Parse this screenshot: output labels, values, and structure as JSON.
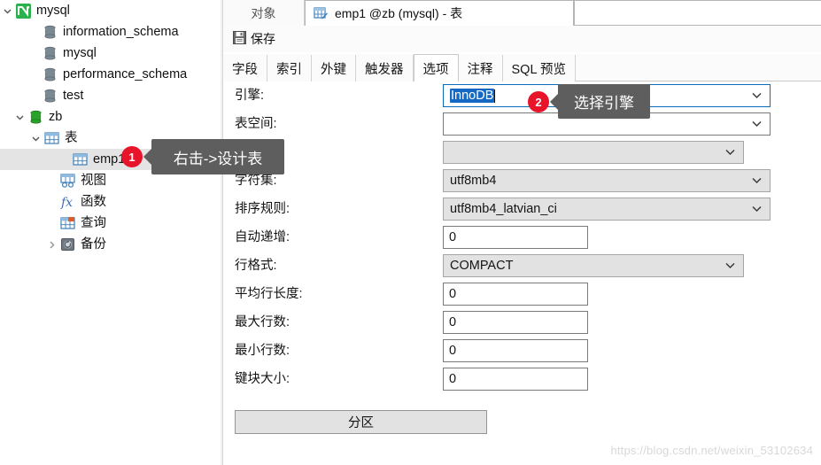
{
  "sidebar": {
    "items": [
      {
        "label": "mysql",
        "icon": "navicat-connection-icon",
        "indent": 0,
        "twisty": "down",
        "selected": false
      },
      {
        "label": "information_schema",
        "icon": "database-icon",
        "indent": 30,
        "twisty": "none",
        "selected": false
      },
      {
        "label": "mysql",
        "icon": "database-icon",
        "indent": 30,
        "twisty": "none",
        "selected": false
      },
      {
        "label": "performance_schema",
        "icon": "database-icon",
        "indent": 30,
        "twisty": "none",
        "selected": false
      },
      {
        "label": "test",
        "icon": "database-icon",
        "indent": 30,
        "twisty": "none",
        "selected": false
      },
      {
        "label": "zb",
        "icon": "database-open-icon",
        "indent": 14,
        "twisty": "down",
        "selected": false
      },
      {
        "label": "表",
        "icon": "table-folder-icon",
        "indent": 32,
        "twisty": "down",
        "selected": false
      },
      {
        "label": "emp1",
        "icon": "table-icon",
        "indent": 64,
        "twisty": "none",
        "selected": true
      },
      {
        "label": "视图",
        "icon": "view-icon",
        "indent": 50,
        "twisty": "none",
        "selected": false
      },
      {
        "label": "函数",
        "icon": "function-icon",
        "indent": 50,
        "twisty": "none",
        "selected": false
      },
      {
        "label": "查询",
        "icon": "query-icon",
        "indent": 50,
        "twisty": "none",
        "selected": false
      },
      {
        "label": "备份",
        "icon": "backup-icon",
        "indent": 50,
        "twisty": "right",
        "selected": false
      }
    ]
  },
  "window_tabs": {
    "object_tab": "对象",
    "active_tab": "emp1 @zb (mysql) - 表"
  },
  "toolbar": {
    "save_label": "保存"
  },
  "inner_tabs": [
    {
      "label": "字段",
      "active": false
    },
    {
      "label": "索引",
      "active": false
    },
    {
      "label": "外键",
      "active": false
    },
    {
      "label": "触发器",
      "active": false
    },
    {
      "label": "选项",
      "active": true
    },
    {
      "label": "注释",
      "active": false
    },
    {
      "label": "SQL 预览",
      "active": false
    }
  ],
  "form": {
    "rows": [
      {
        "label": "引擎:",
        "value": "InnoDB",
        "type": "combo-editable-focused",
        "selected": true
      },
      {
        "label": "表空间:",
        "value": "",
        "type": "combo-editable"
      },
      {
        "label": "",
        "value": "",
        "type": "combo-short"
      },
      {
        "label": "字符集:",
        "value": "utf8mb4",
        "type": "combo"
      },
      {
        "label": "排序规则:",
        "value": "utf8mb4_latvian_ci",
        "type": "combo"
      },
      {
        "label": "自动递增:",
        "value": "0",
        "type": "textbox"
      },
      {
        "label": "行格式:",
        "value": "COMPACT",
        "type": "combo-medium"
      },
      {
        "label": "平均行长度:",
        "value": "0",
        "type": "textbox"
      },
      {
        "label": "最大行数:",
        "value": "0",
        "type": "textbox"
      },
      {
        "label": "最小行数:",
        "value": "0",
        "type": "textbox"
      },
      {
        "label": "键块大小:",
        "value": "0",
        "type": "textbox"
      }
    ],
    "partition_button": "分区"
  },
  "callouts": [
    {
      "badge": "1",
      "text": "右击->设计表"
    },
    {
      "badge": "2",
      "text": "选择引擎"
    }
  ],
  "watermark": "https://blog.csdn.net/weixin_53102634",
  "colors": {
    "accent_blue": "#1669c3",
    "badge_red": "#e8142a",
    "callout_gray": "#5e5e5e",
    "db_green": "#2aa32a",
    "table_blue": "#3d7ebc"
  }
}
